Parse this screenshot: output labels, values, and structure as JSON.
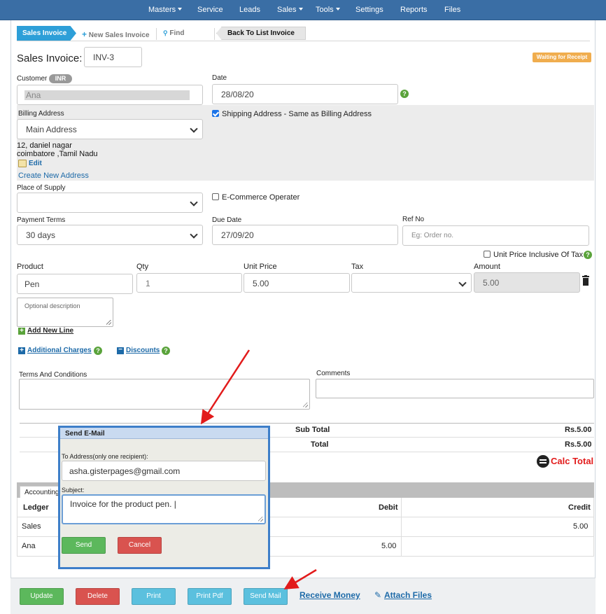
{
  "nav": {
    "items": [
      {
        "label": "Masters",
        "dropdown": true
      },
      {
        "label": "Service",
        "dropdown": false
      },
      {
        "label": "Leads",
        "dropdown": false
      },
      {
        "label": "Sales",
        "dropdown": true
      },
      {
        "label": "Tools",
        "dropdown": true
      },
      {
        "label": "Settings",
        "dropdown": false
      },
      {
        "label": "Reports",
        "dropdown": false
      },
      {
        "label": "Files",
        "dropdown": false
      }
    ]
  },
  "tabs": {
    "active": "Sales Invoice",
    "new": "New Sales Invoice",
    "find": "Find",
    "back": "Back To List Invoice"
  },
  "invoice": {
    "title": "Sales Invoice:",
    "number": "INV-3",
    "status": "Waiting for Receipt"
  },
  "customer": {
    "label": "Customer",
    "currency": "INR",
    "value": "Ana"
  },
  "date": {
    "label": "Date",
    "value": "28/08/20"
  },
  "billing": {
    "label": "Billing Address",
    "selected": "Main Address",
    "line1": "12, daniel nagar",
    "line2": "coimbatore ,Tamil Nadu",
    "edit": "Edit",
    "create": "Create New Address"
  },
  "shipping": {
    "label": "Shipping Address - Same as Billing Address",
    "checked": true
  },
  "place_of_supply": {
    "label": "Place of Supply",
    "selected": ""
  },
  "ecommerce": {
    "label": "E-Commerce Operater",
    "checked": false
  },
  "payment_terms": {
    "label": "Payment Terms",
    "selected": "30 days"
  },
  "due_date": {
    "label": "Due Date",
    "value": "27/09/20"
  },
  "ref_no": {
    "label": "Ref No",
    "placeholder": "Eg: Order no."
  },
  "unit_price_inclusive": {
    "label": "Unit Price Inclusive Of Tax",
    "checked": false
  },
  "line_items": {
    "headers": {
      "product": "Product",
      "qty": "Qty",
      "unit_price": "Unit Price",
      "tax": "Tax",
      "amount": "Amount"
    },
    "row": {
      "product": "Pen",
      "qty": "1",
      "unit_price": "5.00",
      "tax": "",
      "amount": "5.00"
    },
    "description_placeholder": "Optional description",
    "add_line": "Add New Line"
  },
  "extras": {
    "additional_charges": "Additional Charges",
    "discounts": "Discounts"
  },
  "terms": {
    "label": "Terms And Conditions"
  },
  "comments": {
    "label": "Comments"
  },
  "totals": {
    "sub_total_label": "Sub Total",
    "sub_total_value": "Rs.5.00",
    "total_label": "Total",
    "total_value": "Rs.5.00",
    "calc": "Calc Total"
  },
  "ledger": {
    "tab": "Accounting",
    "headers": {
      "ledger": "Ledger",
      "debit": "Debit",
      "credit": "Credit"
    },
    "rows": [
      {
        "ledger": "Sales",
        "debit": "",
        "credit": "5.00"
      },
      {
        "ledger": "Ana",
        "debit": "5.00",
        "credit": ""
      }
    ]
  },
  "email_modal": {
    "title": "Send E-Mail",
    "to_label": "To Address(only one recipient):",
    "to_value": "asha.gisterpages@gmail.com",
    "subject_label": "Subject:",
    "subject_value": "Invoice for the product pen. |",
    "send": "Send",
    "cancel": "Cancel"
  },
  "actions": {
    "update": "Update",
    "delete": "Delete",
    "print": "Print",
    "print_pdf": "Print Pdf",
    "send_mail": "Send Mail",
    "receive_money": "Receive Money",
    "attach_files": "Attach Files"
  },
  "colors": {
    "nav": "#3a6ea5",
    "tab_active": "#2d9fd8",
    "status_badge": "#f0ad4e",
    "update": "#5cb85c",
    "delete": "#d9534f",
    "print": "#5bc0de",
    "calc": "#e21b1b",
    "arrow": "#e21b1b",
    "modal_border": "#3e7fc9"
  }
}
